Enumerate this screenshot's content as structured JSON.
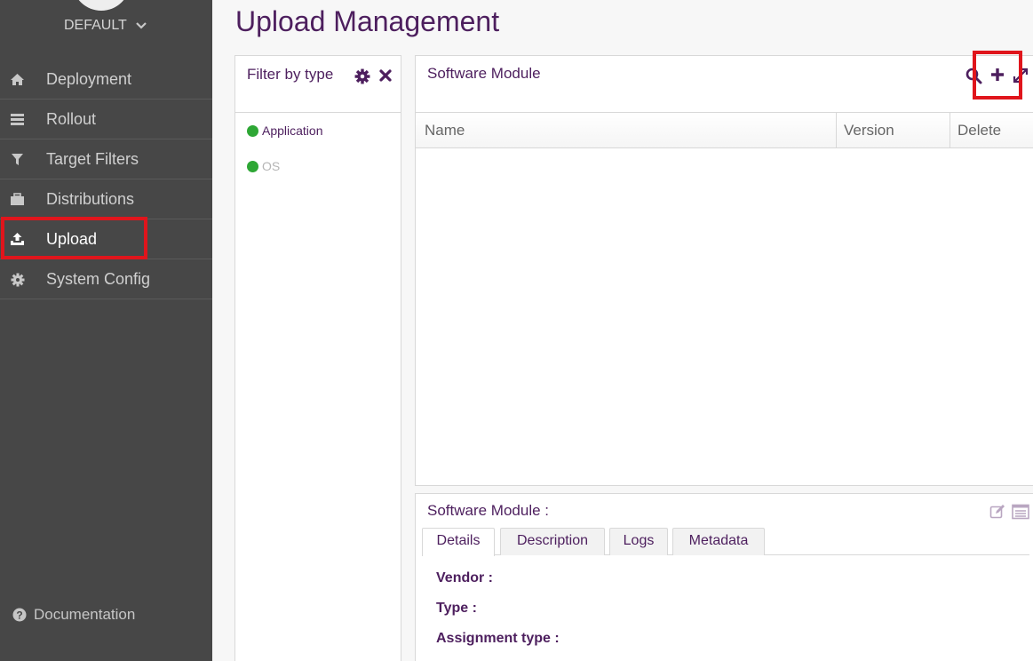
{
  "sidebar": {
    "tenant": "DEFAULT",
    "items": [
      {
        "label": "Deployment",
        "icon": "home-icon"
      },
      {
        "label": "Rollout",
        "icon": "rollout-icon"
      },
      {
        "label": "Target Filters",
        "icon": "filter-icon"
      },
      {
        "label": "Distributions",
        "icon": "briefcase-icon"
      },
      {
        "label": "Upload",
        "icon": "upload-icon",
        "active": true
      },
      {
        "label": "System Config",
        "icon": "gear-icon"
      }
    ],
    "docs_label": "Documentation"
  },
  "page": {
    "title": "Upload Management"
  },
  "filter": {
    "title": "Filter by type",
    "types": [
      {
        "label": "Application",
        "color": "#2ea735",
        "text_color": "#4d1f5e"
      },
      {
        "label": "OS",
        "color": "#2ea735",
        "text_color": "#b5b5b5"
      }
    ]
  },
  "software_module": {
    "title": "Software Module",
    "columns": [
      "Name",
      "Version",
      "Delete"
    ]
  },
  "details": {
    "title": "Software Module :",
    "tabs": [
      "Details",
      "Description",
      "Logs",
      "Metadata"
    ],
    "fields": [
      "Vendor :",
      "Type :",
      "Assignment type :"
    ]
  },
  "colors": {
    "accent": "#4d1f5e",
    "sidebar_bg": "#474747",
    "highlight": "#e0151c",
    "status_green": "#2ea735"
  }
}
